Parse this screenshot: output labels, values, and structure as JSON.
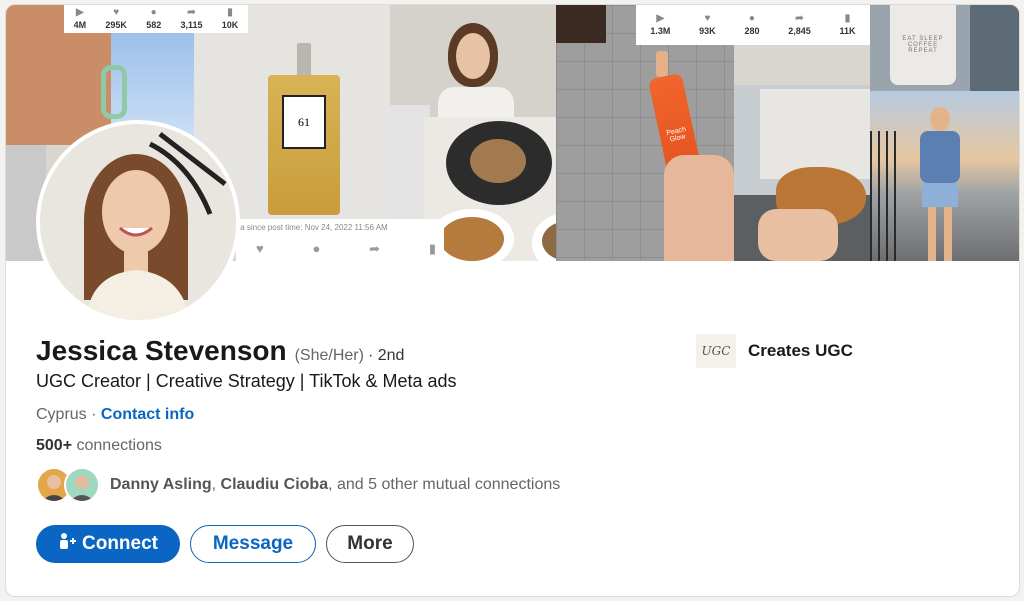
{
  "cover": {
    "stats_left": [
      {
        "icon": "play-icon",
        "value": "4M"
      },
      {
        "icon": "heart-icon",
        "value": "295K"
      },
      {
        "icon": "comment-icon",
        "value": "582"
      },
      {
        "icon": "share-icon",
        "value": "3,115"
      },
      {
        "icon": "bookmark-icon",
        "value": "10K"
      }
    ],
    "stats_right": [
      {
        "icon": "play-icon",
        "value": "1.3M"
      },
      {
        "icon": "heart-icon",
        "value": "93K"
      },
      {
        "icon": "comment-icon",
        "value": "280"
      },
      {
        "icon": "share-icon",
        "value": "2,845"
      },
      {
        "icon": "bookmark-icon",
        "value": "11K"
      }
    ],
    "perfume_label": "61",
    "post_timestamp": "ta since post time: Nov 24, 2022 11:56 AM",
    "serum_label": "Peach Glow",
    "cup_text": "EAT SLEEP COFFEE REPEAT"
  },
  "profile": {
    "name": "Jessica Stevenson",
    "pronouns": "(She/Her)",
    "degree": "· 2nd",
    "headline": "UGC Creator | Creative Strategy | TikTok & Meta ads",
    "location": "Cyprus",
    "location_sep": " · ",
    "contact_info": "Contact info",
    "connections_count": "500+",
    "connections_label": " connections",
    "mutual_names_1": "Danny Asling",
    "mutual_sep": ", ",
    "mutual_names_2": "Claudiu Cioba",
    "mutual_rest": ", and 5 other mutual connections"
  },
  "company": {
    "logo_text": "UGC",
    "name": "Creates UGC"
  },
  "actions": {
    "connect": "Connect",
    "message": "Message",
    "more": "More"
  },
  "colors": {
    "accent": "#0a66c2",
    "text": "#191919",
    "muted": "#666666"
  }
}
